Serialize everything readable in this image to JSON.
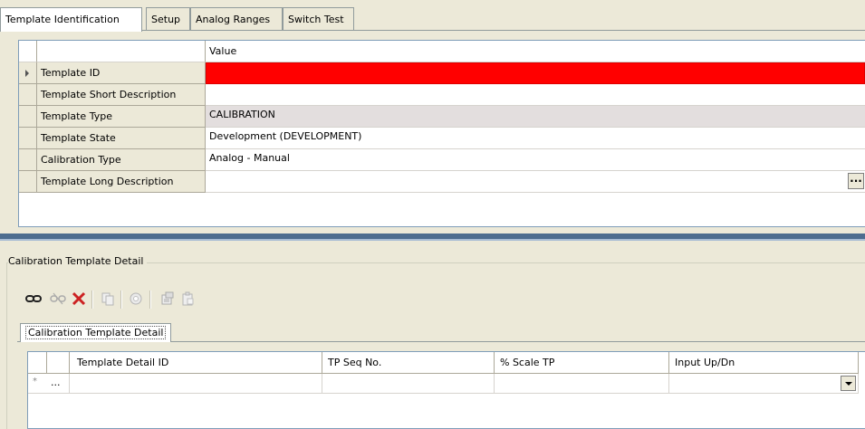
{
  "tabs": [
    {
      "label": "Template Identification",
      "active": true
    },
    {
      "label": "Setup",
      "active": false
    },
    {
      "label": "Analog Ranges",
      "active": false
    },
    {
      "label": "Switch Test",
      "active": false
    }
  ],
  "property_grid": {
    "value_header": "Value",
    "rows": [
      {
        "label": "Template ID",
        "value": "",
        "state": "required-error"
      },
      {
        "label": "Template Short Description",
        "value": ""
      },
      {
        "label": "Template Type",
        "value": "CALIBRATION",
        "state": "readonly"
      },
      {
        "label": "Template State",
        "value": "Development (DEVELOPMENT)"
      },
      {
        "label": "Calibration Type",
        "value": "Analog - Manual"
      },
      {
        "label": "Template Long Description",
        "value": "",
        "button": "..."
      }
    ]
  },
  "detail": {
    "group_title": "Calibration Template Detail",
    "toolbar": {
      "icons": [
        "link-icon",
        "unlink-icon",
        "delete-icon",
        "copy-icon",
        "paste-icon",
        "properties-icon",
        "clipboard-icon"
      ],
      "enabled": [
        true,
        false,
        true,
        false,
        false,
        false,
        false
      ]
    },
    "tab_label": "Calibration Template Detail",
    "columns": [
      "Template Detail ID",
      "TP Seq No.",
      "% Scale TP",
      "Input Up/Dn"
    ],
    "new_row": {
      "marker": "*",
      "button": "..."
    }
  },
  "colors": {
    "error": "#ff0000",
    "splitter": "#4d6d8f",
    "window_bg": "#ece9d8",
    "delete": "#cc2222"
  }
}
